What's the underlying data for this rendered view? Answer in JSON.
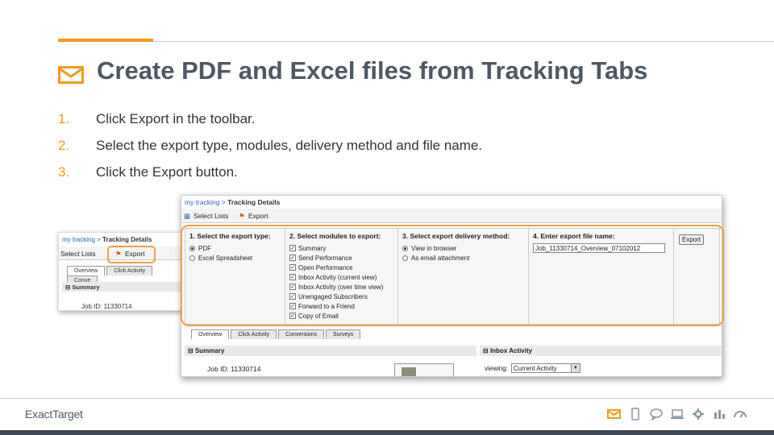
{
  "slide": {
    "title": "Create PDF and Excel files from Tracking Tabs",
    "steps": [
      {
        "num": "1.",
        "text": "Click Export in the toolbar."
      },
      {
        "num": "2.",
        "text": "Select the export type, modules, delivery method and file name."
      },
      {
        "num": "3.",
        "text": "Click the Export button."
      }
    ]
  },
  "small_shot": {
    "crumb_link": "my tracking",
    "crumb_sep": " > ",
    "crumb_current": "Tracking Details",
    "select_lists": "Select Lists",
    "export": "Export",
    "tabs": [
      "Overview",
      "Click Activity",
      "Conve"
    ],
    "summary": "Summary",
    "job_id": "Job ID: 11330714"
  },
  "big_shot": {
    "crumb_link": "my tracking",
    "crumb_sep": " > ",
    "crumb_current": "Tracking Details",
    "select_lists": "Select Lists",
    "export": "Export",
    "col1_heading": "1. Select the export type:",
    "export_types": [
      {
        "label": "PDF",
        "selected": true
      },
      {
        "label": "Excel Spreadsheet",
        "selected": false
      }
    ],
    "col2_heading": "2. Select modules to export:",
    "modules": [
      "Summary",
      "Send Performance",
      "Open Performance",
      "Inbox Activity (current view)",
      "Inbox Activity (over time view)",
      "Unengaged Subscribers",
      "Forward to a Friend",
      "Copy of Email"
    ],
    "col3_heading": "3. Select export delivery method:",
    "delivery": [
      {
        "label": "View in browser",
        "selected": true
      },
      {
        "label": "As email attachment",
        "selected": false
      }
    ],
    "col4_heading": "4. Enter export file name:",
    "file_name": "Job_11330714_Overview_07102012",
    "export_button": "Export",
    "tabs": [
      "Overview",
      "Click Activity",
      "Conversions",
      "Surveys"
    ],
    "summary": "Summary",
    "inbox_activity": "Inbox Activity",
    "job_id": "Job ID: 11330714",
    "viewing_label": "viewing:",
    "viewing_value": "Current Activity"
  },
  "footer": {
    "logo": "ExactTarget",
    "icons": [
      "envelope-icon",
      "mobile-icon",
      "chat-icon",
      "laptop-icon",
      "gear-icon",
      "bar-chart-icon",
      "gauge-icon"
    ]
  },
  "colors": {
    "accent": "#f39c1e",
    "title": "#4d5864",
    "highlight": "#f0a042",
    "footer_bar": "#3f4a56"
  }
}
